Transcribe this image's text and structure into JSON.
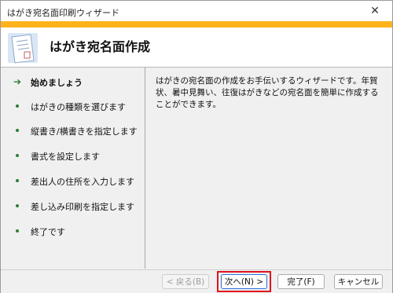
{
  "window": {
    "title": "はがき宛名面印刷ウィザード",
    "close_glyph": "✕"
  },
  "header": {
    "title": "はがき宛名面作成",
    "accent_color": "#ffb21a"
  },
  "steps": [
    {
      "label": "始めましょう",
      "current": true
    },
    {
      "label": "はがきの種類を選びます",
      "current": false
    },
    {
      "label": "縦書き/横書きを指定します",
      "current": false
    },
    {
      "label": "書式を設定します",
      "current": false
    },
    {
      "label": "差出人の住所を入力します",
      "current": false
    },
    {
      "label": "差し込み印刷を指定します",
      "current": false
    },
    {
      "label": "終了です",
      "current": false
    }
  ],
  "description": "はがきの宛名面の作成をお手伝いするウィザードです。年賀状、暑中見舞い、往復はがきなどの宛名面を簡単に作成することができます。",
  "buttons": {
    "back": "< 戻る(B)",
    "next": "次へ(N) >",
    "finish": "完了(F)",
    "cancel": "キャンセル"
  },
  "highlight_color": "#e0141e"
}
